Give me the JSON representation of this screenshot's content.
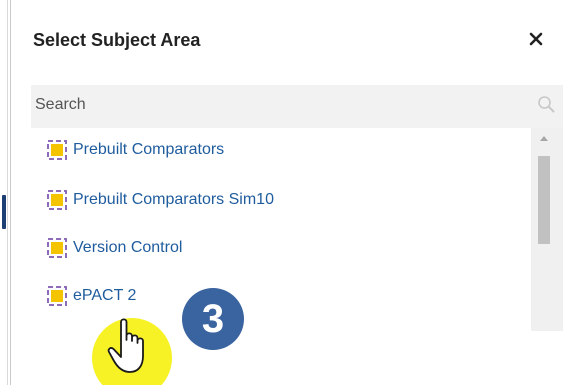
{
  "dialog": {
    "title": "Select Subject Area",
    "close_icon": "close-icon"
  },
  "search": {
    "placeholder": "Search",
    "value": "",
    "icon": "search-icon"
  },
  "subject_areas": [
    {
      "label": "Prebuilt Comparators",
      "icon": "subject-area-icon"
    },
    {
      "label": "Prebuilt Comparators Sim10",
      "icon": "subject-area-icon"
    },
    {
      "label": "Version Control",
      "icon": "subject-area-icon"
    },
    {
      "label": "ePACT 2",
      "icon": "subject-area-icon"
    }
  ],
  "tutorial": {
    "step_number": "3",
    "cursor_icon": "hand-pointer-icon"
  },
  "colors": {
    "link": "#1f5c9e",
    "panel_bg": "#f2f2f2",
    "step_badge": "#3a64a0",
    "cursor_highlight": "#f4f000",
    "icon_gold": "#f5c400",
    "icon_purple": "#8d6bb8"
  }
}
